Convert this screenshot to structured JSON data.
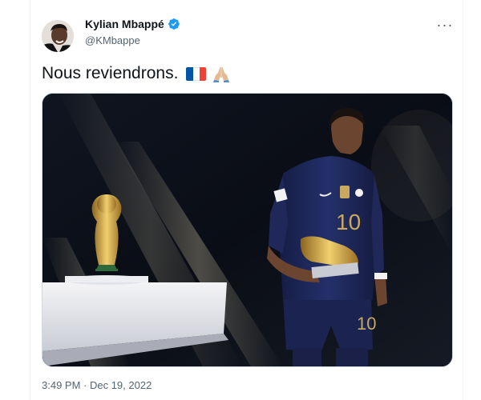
{
  "tweet": {
    "display_name": "Kylian Mbappé",
    "handle": "@KMbappe",
    "text": "Nous reviendrons.",
    "emoji": [
      "flag-france",
      "folded-hands"
    ],
    "timestamp": "3:49 PM · Dec 19, 2022",
    "more_label": "···"
  },
  "media": {
    "jersey_number": "10",
    "jersey_number_shorts": "10"
  },
  "colors": {
    "text_primary": "#0f1419",
    "text_secondary": "#536471",
    "verified_blue": "#1d9bf0",
    "flag_blue": "#0055a4",
    "flag_white": "#ffffff",
    "flag_red": "#ef4135",
    "jersey_navy": "#1b2350",
    "gold": "#d4a84a"
  }
}
